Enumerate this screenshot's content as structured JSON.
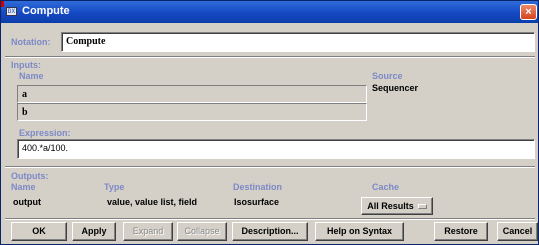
{
  "window": {
    "title": "Compute",
    "app_icon_text": "DX",
    "close_glyph": "×"
  },
  "notation": {
    "label": "Notation:",
    "value": "Compute"
  },
  "inputs": {
    "section_label": "Inputs:",
    "name_header": "Name",
    "source_header": "Source",
    "source_value": "Sequencer",
    "rows": [
      "a",
      "b"
    ]
  },
  "expression": {
    "label": "Expression:",
    "value": "400.*a/100."
  },
  "outputs": {
    "section_label": "Outputs:",
    "headers": {
      "name": "Name",
      "type": "Type",
      "destination": "Destination",
      "cache": "Cache"
    },
    "row": {
      "name": "output",
      "type": "value, value list, field",
      "destination": "Isosurface",
      "cache": "All Results"
    }
  },
  "buttons": {
    "ok": "OK",
    "apply": "Apply",
    "expand": "Expand",
    "collapse": "Collapse",
    "description": "Description...",
    "help_on_syntax": "Help on Syntax",
    "restore": "Restore",
    "cancel": "Cancel"
  },
  "colors": {
    "title_bar": "#1549c4",
    "section_label": "#7d89c7",
    "dialog_bg": "#d4d0c8",
    "close_button": "#d4431e"
  }
}
